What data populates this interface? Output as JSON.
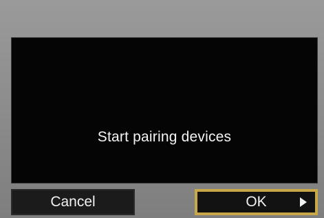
{
  "dialog": {
    "message": "Start pairing devices"
  },
  "buttons": {
    "cancel_label": "Cancel",
    "ok_label": "OK",
    "ok_icon": "arrow-right-icon"
  },
  "colors": {
    "dialog_background": "#050505",
    "frame_background": "#8c8c8c",
    "button_background": "#1b1b1b",
    "selected_border": "#c9a84a",
    "text": "#f2f2f2"
  }
}
